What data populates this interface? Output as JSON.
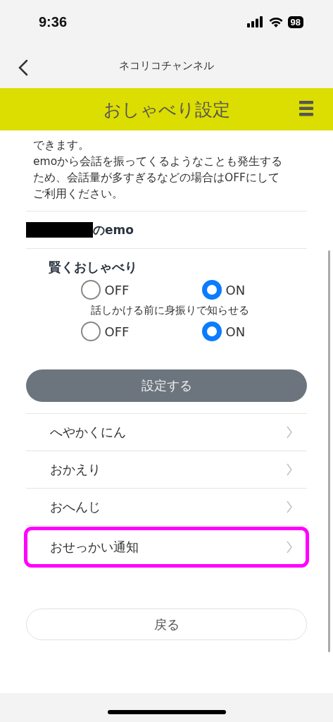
{
  "status_bar": {
    "time": "9:36",
    "battery": "98"
  },
  "nav": {
    "title": "ネコリコチャンネル"
  },
  "header": {
    "title": "おしゃべり設定"
  },
  "description": {
    "lines": [
      "できます。",
      "emoから会話を振ってくるようなことも発生する",
      "ため、会話量が多すぎるなどの場合はOFFにして",
      "ご利用ください。"
    ]
  },
  "device": {
    "name_redacted": true,
    "suffix": "のemo"
  },
  "section_title": "賢くおしゃべり",
  "settings": [
    {
      "options": [
        {
          "label": "OFF",
          "selected": false
        },
        {
          "label": "ON",
          "selected": true
        }
      ]
    },
    {
      "label": "話しかける前に身振りで知らせる",
      "options": [
        {
          "label": "OFF",
          "selected": false
        },
        {
          "label": "ON",
          "selected": true
        }
      ]
    }
  ],
  "submit_button": "設定する",
  "menu": [
    {
      "label": "へやかくにん",
      "highlighted": false
    },
    {
      "label": "おかえり",
      "highlighted": false
    },
    {
      "label": "おへんじ",
      "highlighted": false
    },
    {
      "label": "おせっかい通知",
      "highlighted": true
    }
  ],
  "back_button": "戻る"
}
